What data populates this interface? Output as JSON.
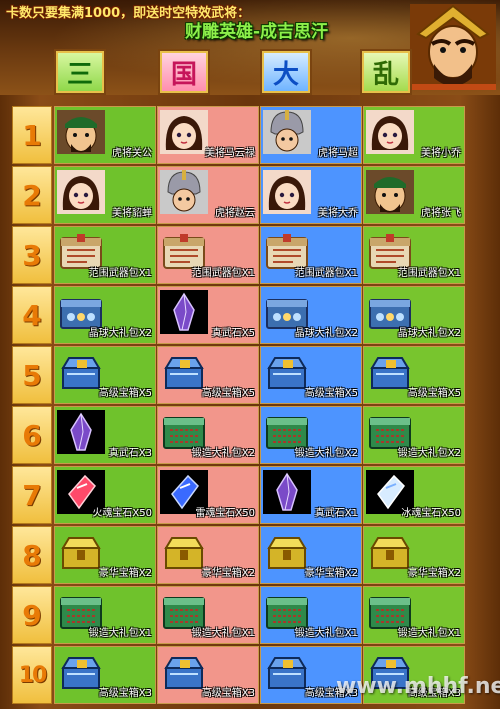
{
  "banner": {
    "promo": "卡数只要集满1000，即送时空特效武将：",
    "hero": "财雕英雄-成吉思汗",
    "title_chars": [
      "三",
      "国",
      "大",
      "乱"
    ]
  },
  "rows": [
    {
      "number": "1",
      "items": [
        {
          "label": "虎将关公",
          "icon": "general-portrait-icon"
        },
        {
          "label": "美将马云禄",
          "icon": "female-general-portrait-icon"
        },
        {
          "label": "虎将马超",
          "icon": "helmet-general-portrait-icon"
        },
        {
          "label": "美将小乔",
          "icon": "female-general-portrait-icon"
        }
      ]
    },
    {
      "number": "2",
      "items": [
        {
          "label": "美将貂蝉",
          "icon": "female-general-portrait-icon"
        },
        {
          "label": "虎将赵云",
          "icon": "helmet-general-portrait-icon"
        },
        {
          "label": "美将大乔",
          "icon": "female-general-portrait-icon"
        },
        {
          "label": "虎将张飞",
          "icon": "general-portrait-icon"
        }
      ]
    },
    {
      "number": "3",
      "items": [
        {
          "label": "范围武器包X1",
          "icon": "weapon-pack-icon"
        },
        {
          "label": "范围武器包X1",
          "icon": "weapon-pack-icon"
        },
        {
          "label": "范围武器包X1",
          "icon": "weapon-pack-icon"
        },
        {
          "label": "范围武器包X1",
          "icon": "weapon-pack-icon"
        }
      ]
    },
    {
      "number": "4",
      "items": [
        {
          "label": "晶球大礼包X2",
          "icon": "crystal-gift-pack-icon"
        },
        {
          "label": "真武石X5",
          "icon": "purple-crystal-icon"
        },
        {
          "label": "晶球大礼包X2",
          "icon": "crystal-gift-pack-icon"
        },
        {
          "label": "晶球大礼包X2",
          "icon": "crystal-gift-pack-icon"
        }
      ]
    },
    {
      "number": "5",
      "items": [
        {
          "label": "高级宝箱X5",
          "icon": "advanced-chest-icon"
        },
        {
          "label": "高级宝箱X5",
          "icon": "advanced-chest-icon"
        },
        {
          "label": "高级宝箱X5",
          "icon": "advanced-chest-icon"
        },
        {
          "label": "高级宝箱X5",
          "icon": "advanced-chest-icon"
        }
      ]
    },
    {
      "number": "6",
      "items": [
        {
          "label": "真武石X3",
          "icon": "purple-crystal-icon"
        },
        {
          "label": "锻造大礼包X2",
          "icon": "forge-gift-pack-icon"
        },
        {
          "label": "锻造大礼包X2",
          "icon": "forge-gift-pack-icon"
        },
        {
          "label": "锻造大礼包X2",
          "icon": "forge-gift-pack-icon"
        }
      ]
    },
    {
      "number": "7",
      "items": [
        {
          "label": "火魂宝石X50",
          "icon": "red-gem-icon"
        },
        {
          "label": "雷魂宝石X50",
          "icon": "blue-gem-icon"
        },
        {
          "label": "真武石X1",
          "icon": "purple-crystal-icon"
        },
        {
          "label": "冰魂宝石X50",
          "icon": "ice-gem-icon"
        }
      ]
    },
    {
      "number": "8",
      "items": [
        {
          "label": "豪华宝箱X2",
          "icon": "luxury-chest-icon"
        },
        {
          "label": "豪华宝箱X2",
          "icon": "luxury-chest-icon"
        },
        {
          "label": "豪华宝箱X2",
          "icon": "luxury-chest-icon"
        },
        {
          "label": "豪华宝箱X2",
          "icon": "luxury-chest-icon"
        }
      ]
    },
    {
      "number": "9",
      "items": [
        {
          "label": "锻造大礼包X1",
          "icon": "forge-gift-pack-icon"
        },
        {
          "label": "锻造大礼包X1",
          "icon": "forge-gift-pack-icon"
        },
        {
          "label": "锻造大礼包X1",
          "icon": "forge-gift-pack-icon"
        },
        {
          "label": "锻造大礼包X1",
          "icon": "forge-gift-pack-icon"
        }
      ]
    },
    {
      "number": "10",
      "items": [
        {
          "label": "高级宝箱X3",
          "icon": "advanced-chest-icon"
        },
        {
          "label": "高级宝箱X3",
          "icon": "advanced-chest-icon"
        },
        {
          "label": "高级宝箱X3",
          "icon": "advanced-chest-icon"
        },
        {
          "label": "高级宝箱X3",
          "icon": "advanced-chest-icon"
        }
      ]
    }
  ],
  "column_colors": [
    "#6fc22c",
    "#f2968b",
    "#4d94ff",
    "#78c52e"
  ],
  "watermark": "www.mhhf.net"
}
